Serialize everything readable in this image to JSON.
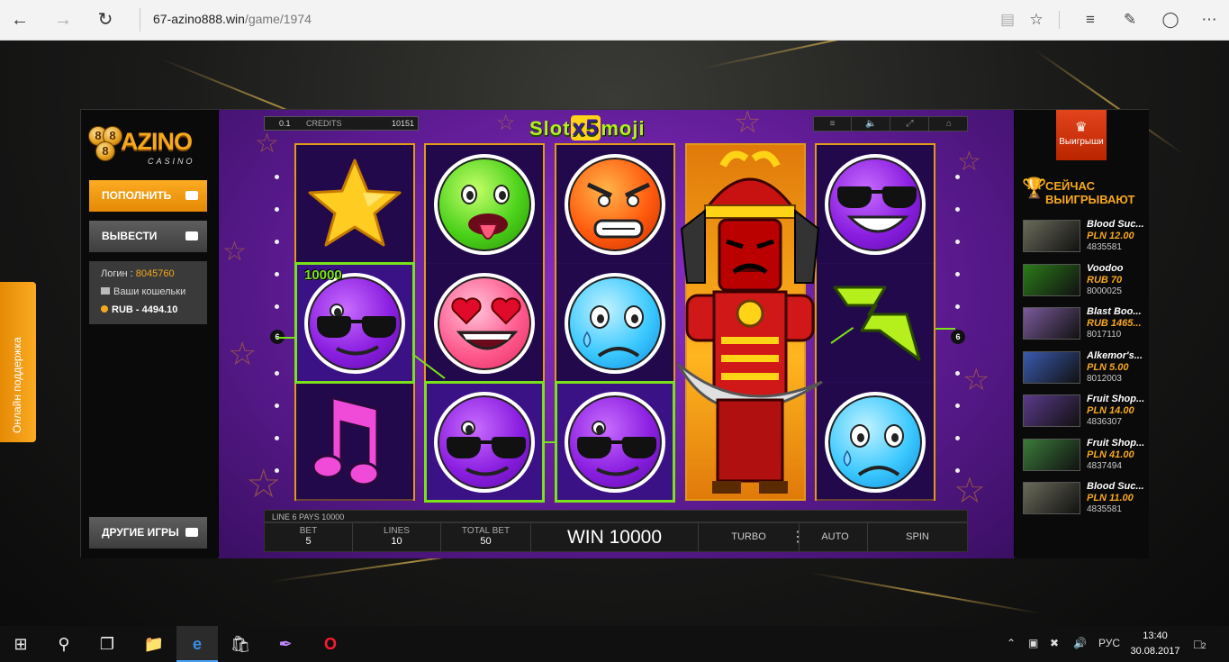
{
  "browser": {
    "url_domain": "67-azino888.win",
    "url_path": "/game/1974"
  },
  "support_tab": {
    "label": "Онлайн поддержка"
  },
  "left_panel": {
    "logo_brand": "AZINO",
    "logo_sub": "CASINO",
    "logo_chip_digit": "8",
    "deposit_label": "ПОПОЛНИТЬ",
    "withdraw_label": "ВЫВЕСТИ",
    "login_label": "Логин :",
    "login_value": "8045760",
    "wallets_label": "Ваши кошельки",
    "balance": "RUB - 4494.10",
    "other_games_label": "ДРУГИЕ ИГРЫ"
  },
  "slot": {
    "title_left": "Slot",
    "title_mult": "x5",
    "title_right": "moji",
    "bet_value": "0.1",
    "credits_label": "CREDITS",
    "credits_value": "10151",
    "win_amount_label": "10000",
    "line_marker": "6",
    "line_info": "LINE 6 PAYS 10000",
    "bet_label": "BET",
    "bet": "5",
    "lines_label": "LINES",
    "lines": "10",
    "total_bet_label": "TOTAL BET",
    "total_bet": "50",
    "win_display": "WIN 10000",
    "turbo_label": "TURBO",
    "auto_label": "AUTO",
    "spin_label": "SPIN"
  },
  "right_panel": {
    "winners_label": "Выигрыши",
    "now_winning": "СЕЙЧАС ВЫИГРЫВАЮТ",
    "winners": [
      {
        "game": "Blood Suc...",
        "amount": "PLN 12.00",
        "id": "4835581",
        "thumb_color": "#6a6a5a"
      },
      {
        "game": "Voodoo",
        "amount": "RUB 70",
        "id": "8000025",
        "thumb_color": "#2b7a1a"
      },
      {
        "game": "Blast Boo...",
        "amount": "RUB 1465...",
        "id": "8017110",
        "thumb_color": "#7a5a9a"
      },
      {
        "game": "Alkemor's...",
        "amount": "PLN 5.00",
        "id": "8012003",
        "thumb_color": "#3a5ab0"
      },
      {
        "game": "Fruit Shop...",
        "amount": "PLN 14.00",
        "id": "4836307",
        "thumb_color": "#5a3a8a"
      },
      {
        "game": "Fruit Shop...",
        "amount": "PLN 41.00",
        "id": "4837494",
        "thumb_color": "#3a7a3a"
      },
      {
        "game": "Blood Suc...",
        "amount": "PLN 11.00",
        "id": "4835581",
        "thumb_color": "#6a6a5a"
      }
    ]
  },
  "taskbar": {
    "lang": "РУС",
    "time": "13:40",
    "date": "30.08.2017",
    "notifications": "2"
  }
}
